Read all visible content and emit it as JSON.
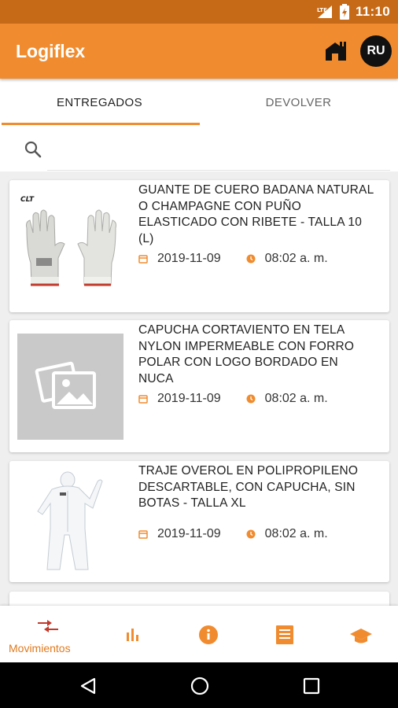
{
  "status_bar": {
    "time": "11:10",
    "network": "LTE"
  },
  "app": {
    "title": "Logiflex",
    "avatar_initials": "RU"
  },
  "tabs": [
    {
      "label": "ENTREGADOS",
      "active": true
    },
    {
      "label": "DEVOLVER",
      "active": false
    }
  ],
  "search": {
    "placeholder": "",
    "value": ""
  },
  "items": [
    {
      "title": "GUANTE DE CUERO BADANA NATURAL O CHAMPAGNE CON PUÑO ELASTICADO CON RIBETE - TALLA 10 (L)",
      "date": "2019-11-09",
      "time": "08:02 a. m.",
      "image": "gloves-photo",
      "brand": "CLT"
    },
    {
      "title": "CAPUCHA CORTAVIENTO EN TELA NYLON IMPERMEABLE CON FORRO POLAR CON LOGO BORDADO EN NUCA",
      "date": "2019-11-09",
      "time": "08:02 a. m.",
      "image": "placeholder-image"
    },
    {
      "title": "TRAJE OVEROL EN POLIPROPILENO DESCARTABLE, CON CAPUCHA, SIN BOTAS - TALLA XL",
      "date": "2019-11-09",
      "time": "08:02 a. m.",
      "image": "coverall-photo"
    }
  ],
  "bottom_nav": [
    {
      "label": "Movimientos",
      "icon": "movements-icon",
      "active": true
    },
    {
      "label": "",
      "icon": "bar-chart-icon"
    },
    {
      "label": "",
      "icon": "info-icon"
    },
    {
      "label": "",
      "icon": "list-icon"
    },
    {
      "label": "",
      "icon": "graduation-cap-icon"
    }
  ],
  "colors": {
    "primary": "#f08c2f",
    "status_bar": "#c66a18",
    "accent_red": "#c0392b",
    "nav_icon": "#f08c2f"
  }
}
